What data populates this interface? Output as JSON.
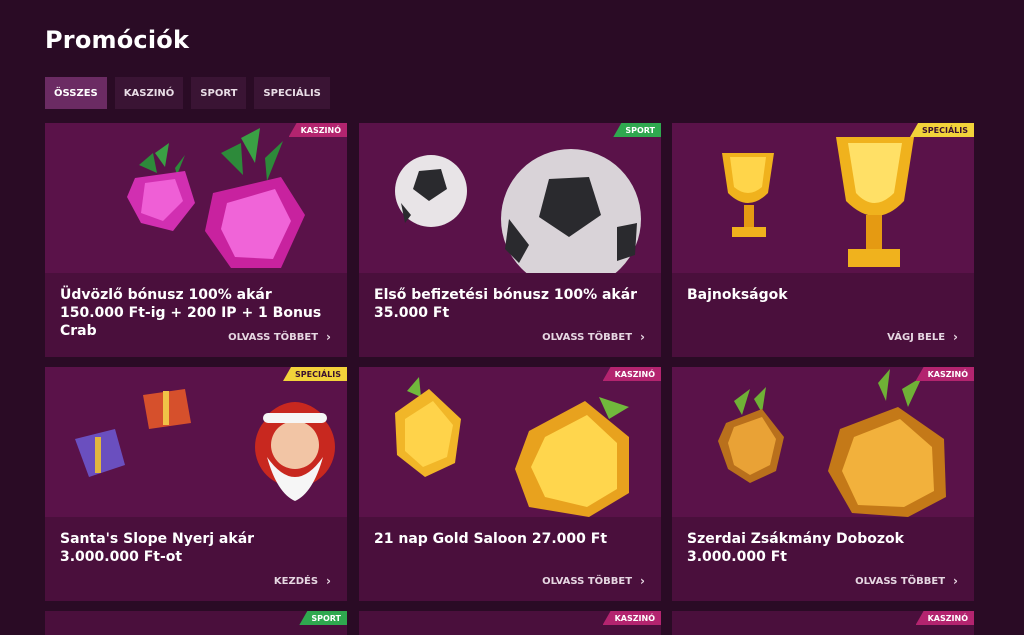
{
  "page": {
    "title": "Promóciók"
  },
  "tabs": [
    {
      "label": "ÖSSZES",
      "active": true
    },
    {
      "label": "KASZINÓ",
      "active": false
    },
    {
      "label": "SPORT",
      "active": false
    },
    {
      "label": "SPECIÁLIS",
      "active": false
    }
  ],
  "cards": [
    {
      "badge": "KASZINÓ",
      "title": "Üdvözlő bónusz 100% akár 150.000 Ft-ig + 200 IP + 1 Bonus Crab",
      "link": "OLVASS TÖBBET",
      "art": "raspberry-icon"
    },
    {
      "badge": "SPORT",
      "title": "Első befizetési bónusz 100% akár 35.000 Ft",
      "link": "OLVASS TÖBBET",
      "art": "football-icon"
    },
    {
      "badge": "SPECIÁLIS",
      "title": "Bajnokságok",
      "link": "VÁGJ BELE",
      "art": "trophy-icon"
    },
    {
      "badge": "SPECIÁLIS",
      "title": "Santa's Slope Nyerj akár 3.000.000 Ft-ot",
      "link": "KEZDÉS",
      "art": "santa-icon"
    },
    {
      "badge": "KASZINÓ",
      "title": "21 nap Gold Saloon 27.000 Ft",
      "link": "OLVASS TÖBBET",
      "art": "lemon-icon"
    },
    {
      "badge": "KASZINÓ",
      "title": "Szerdai Zsákmány Dobozok 3.000.000 Ft",
      "link": "OLVASS TÖBBET",
      "art": "pineapple-icon"
    },
    {
      "badge": "SPORT"
    },
    {
      "badge": "KASZINÓ"
    },
    {
      "badge": "KASZINÓ"
    }
  ],
  "colors": {
    "background": "#2a0b25",
    "card": "#4a0f3c",
    "badge_kaszino": "#b3246f",
    "badge_sport": "#2fa84f",
    "badge_specialis": "#f2d33a"
  }
}
